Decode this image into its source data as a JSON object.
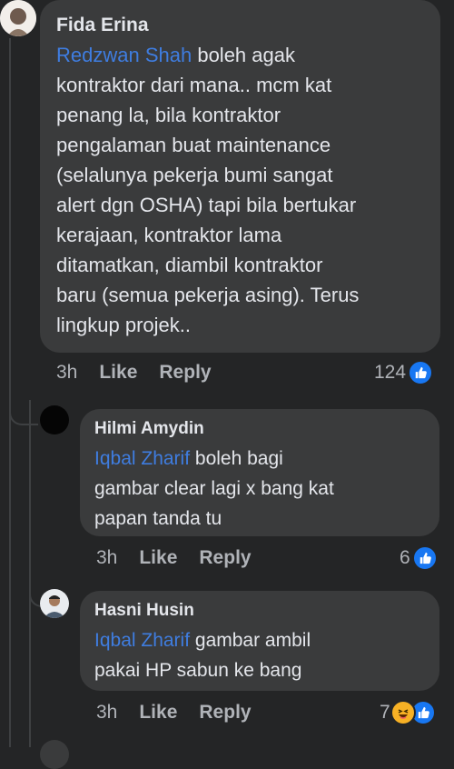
{
  "comments": [
    {
      "author": "Fida Erina",
      "mention": "Redzwan Shah",
      "text_lines": [
        " boleh agak",
        "kontraktor dari mana.. mcm kat",
        "penang la, bila kontraktor",
        "pengalaman buat maintenance",
        "(selalunya pekerja bumi sangat",
        "alert dgn OSHA) tapi bila bertukar",
        "kerajaan, kontraktor lama",
        "ditamatkan, diambil kontraktor",
        "baru (semua pekerja asing). Terus",
        "lingkup projek.."
      ],
      "time": "3h",
      "like_label": "Like",
      "reply_label": "Reply",
      "reaction_count": "124",
      "reaction_icons": [
        "like-icon"
      ]
    },
    {
      "author": "Hilmi Amydin",
      "mention": "Iqbal Zharif",
      "text_lines": [
        " boleh bagi",
        "gambar clear lagi x bang kat",
        "papan tanda tu"
      ],
      "time": "3h",
      "like_label": "Like",
      "reply_label": "Reply",
      "reaction_count": "6",
      "reaction_icons": [
        "like-icon"
      ]
    },
    {
      "author": "Hasni Husin",
      "mention": "Iqbal Zharif",
      "text_lines": [
        " gambar ambil",
        "pakai HP sabun ke bang"
      ],
      "time": "3h",
      "like_label": "Like",
      "reply_label": "Reply",
      "reaction_count": "7",
      "reaction_icons": [
        "haha-icon",
        "like-icon"
      ]
    }
  ],
  "colors": {
    "background": "#242526",
    "bubble": "#3a3b3c",
    "mention": "#3f7de0",
    "meta": "#b0b3b8",
    "like_blue": "#1877f2"
  }
}
